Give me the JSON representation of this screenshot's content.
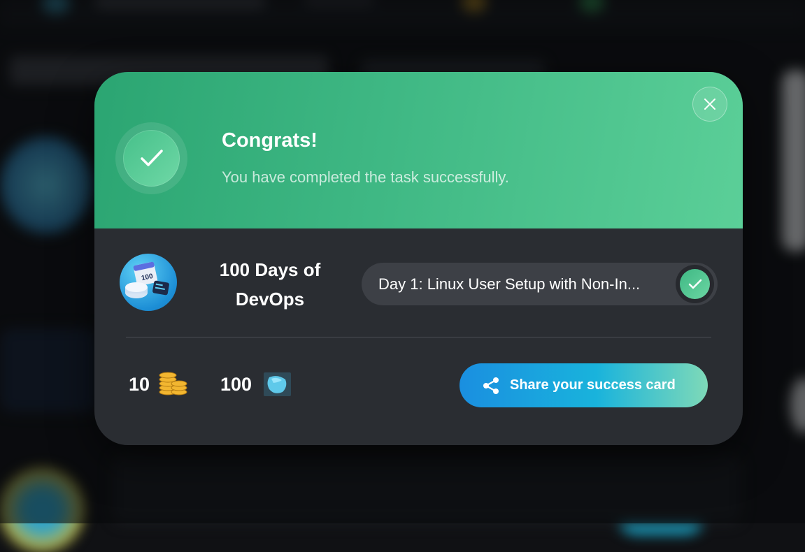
{
  "modal": {
    "title": "Congrats!",
    "subtitle": "You have completed the task successfully.",
    "close_icon": "close-icon",
    "success_icon": "check-icon"
  },
  "course": {
    "name": "100 Days of DevOps",
    "logo_icon": "devops-badge-icon"
  },
  "task": {
    "label": "Day 1: Linux User Setup with Non-In...",
    "status_icon": "check-icon"
  },
  "rewards": {
    "coins": "10",
    "coins_icon": "coin-stack-icon",
    "gems": "100",
    "gems_icon": "gem-icon"
  },
  "share": {
    "label": "Share your success card",
    "icon": "share-icon"
  },
  "colors": {
    "header_start": "#2ba572",
    "header_end": "#5bcf98",
    "modal_bg": "#2a2d32",
    "task_pill_bg": "#3d4046",
    "share_start": "#1a8fe0",
    "share_end": "#7ed9b8"
  }
}
